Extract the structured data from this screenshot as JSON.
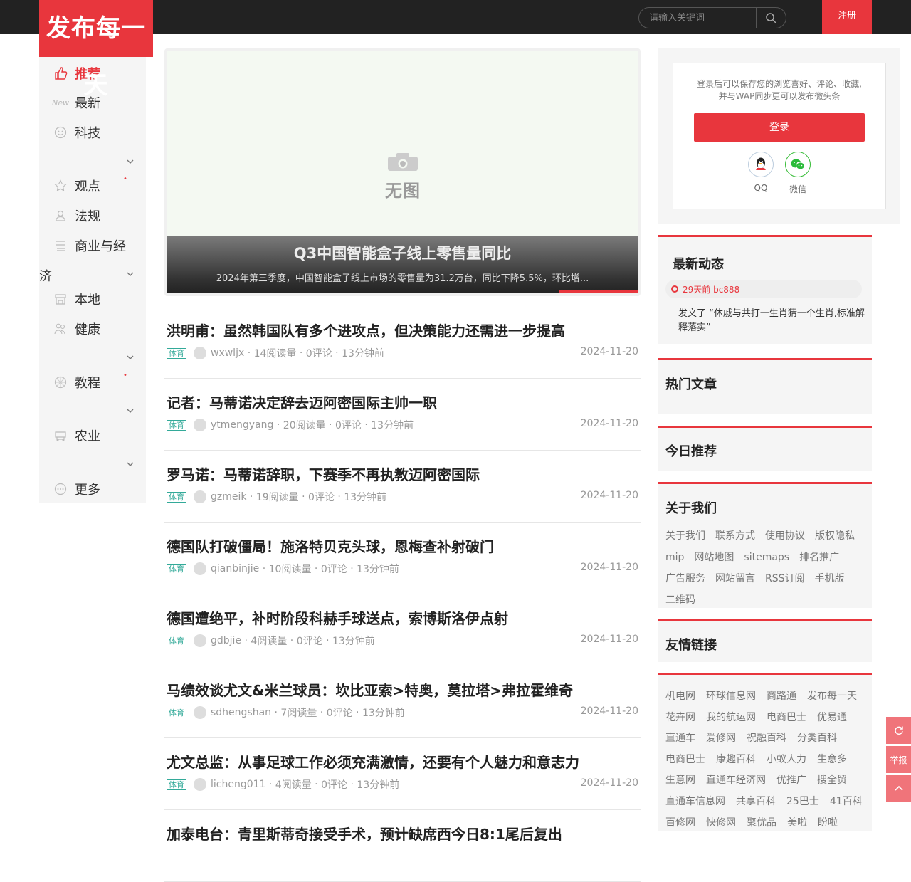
{
  "header": {
    "logo_text": "发布每一天",
    "search_placeholder": "请输入关键词",
    "register_label": "注册"
  },
  "nav": {
    "items": [
      {
        "label": "推荐",
        "icon": "thumbs-up-icon"
      },
      {
        "label": "最新",
        "icon": "new-icon"
      },
      {
        "label": "科技",
        "icon": "smile-icon"
      },
      {
        "label": "观点",
        "icon": "star-icon"
      },
      {
        "label": "法规",
        "icon": "user-icon"
      },
      {
        "label": "商业与经",
        "icon": "list-icon"
      },
      {
        "label": "本地",
        "icon": "store-icon"
      },
      {
        "label": "健康",
        "icon": "people-icon"
      },
      {
        "label": "教程",
        "icon": "ball-icon"
      },
      {
        "label": "农业",
        "icon": "tractor-icon"
      },
      {
        "label": "更多",
        "icon": "more-icon"
      }
    ],
    "wrapped_text": "济",
    "dot": "•"
  },
  "hero": {
    "placeholder_text": "无图",
    "title": "Q3中国智能盒子线上零售量同比",
    "desc": "2024年第三季度，中国智能盒子线上市场的零售量为31.2万台，同比下降5.5%，环比增..."
  },
  "articles": [
    {
      "title": "洪明甫：虽然韩国队有多个进攻点，但决策能力还需进一步提高",
      "tag": "体育",
      "author": "wxwljx",
      "reads": "14阅读量",
      "comments": "0评论",
      "time": "13分钟前",
      "date": "2024-11-20"
    },
    {
      "title": "记者：马蒂诺决定辞去迈阿密国际主帅一职",
      "tag": "体育",
      "author": "ytmengyang",
      "reads": "20阅读量",
      "comments": "0评论",
      "time": "13分钟前",
      "date": "2024-11-20"
    },
    {
      "title": "罗马诺：马蒂诺辞职，下赛季不再执教迈阿密国际",
      "tag": "体育",
      "author": "gzmeik",
      "reads": "19阅读量",
      "comments": "0评论",
      "time": "13分钟前",
      "date": "2024-11-20"
    },
    {
      "title": "德国队打破僵局！施洛特贝克头球，恩梅查补射破门",
      "tag": "体育",
      "author": "qianbinjie",
      "reads": "10阅读量",
      "comments": "0评论",
      "time": "13分钟前",
      "date": "2024-11-20"
    },
    {
      "title": "德国遭绝平，补时阶段科赫手球送点，索博斯洛伊点射",
      "tag": "体育",
      "author": "gdbjie",
      "reads": "4阅读量",
      "comments": "0评论",
      "time": "13分钟前",
      "date": "2024-11-20"
    },
    {
      "title": "马绩效谈尤文&米兰球员：坎比亚索>特奥，莫拉塔>弗拉霍维奇",
      "tag": "体育",
      "author": "sdhengshan",
      "reads": "7阅读量",
      "comments": "0评论",
      "time": "13分钟前",
      "date": "2024-11-20"
    },
    {
      "title": "尤文总监：从事足球工作必须充满激情，还要有个人魅力和意志力",
      "tag": "体育",
      "author": "licheng011",
      "reads": "4阅读量",
      "comments": "0评论",
      "time": "13分钟前",
      "date": "2024-11-20"
    },
    {
      "title": "加泰电台：青里斯蒂奇接受手术，预计缺席西今日8:1尾后复出",
      "tag": "",
      "author": "",
      "reads": "",
      "comments": "",
      "time": "",
      "date": ""
    }
  ],
  "login": {
    "tip_line1": "登录后可以保存您的浏览喜好、评论、收藏,",
    "tip_line2": "并与WAP同步更可以发布微头条",
    "button_label": "登录",
    "qq_label": "QQ",
    "wechat_label": "微信"
  },
  "latest": {
    "heading": "最新动态",
    "item_meta": "29天前 bc888",
    "item_text": "发文了 “休戚与共打一生肖猜一个生肖,标准解释落实”"
  },
  "hot": {
    "heading": "热门文章"
  },
  "today": {
    "heading": "今日推荐"
  },
  "about": {
    "heading": "关于我们",
    "links": [
      "关于我们",
      "联系方式",
      "使用协议",
      "版权隐私",
      "mip",
      "网站地图",
      "sitemaps",
      "排名推广",
      "广告服务",
      "网站留言",
      "RSS订阅",
      "手机版",
      "二维码"
    ]
  },
  "friends": {
    "heading": "友情链接",
    "links": [
      "机电网",
      "环球信息网",
      "商路通",
      "发布每一天",
      "花卉网",
      "我的航运网",
      "电商巴士",
      "优易通",
      "直通车",
      "爱修网",
      "祝融百科",
      "分类百科",
      "电商巴士",
      "康趣百科",
      "小蚁人力",
      "生意多",
      "生意网",
      "直通车经济网",
      "优推广",
      "搜全贸",
      "直通车信息网",
      "共享百科",
      "25巴士",
      "41百科",
      "百修网",
      "快修网",
      "聚优品",
      "美啦",
      "盼啦"
    ]
  },
  "float": {
    "report_label": "举报"
  },
  "colors": {
    "accent": "#e8363d",
    "topbar": "#222222",
    "tag": "#33aa99"
  }
}
